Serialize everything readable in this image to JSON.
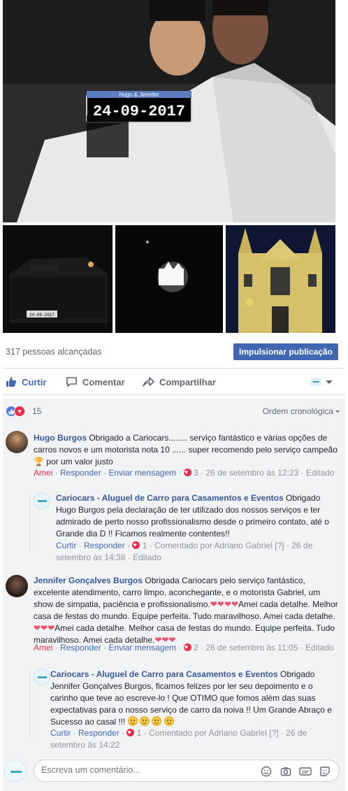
{
  "post": {
    "reach_text": "317 pessoas alcançadas",
    "boost_label": "Impulsionar publicação",
    "plate_name": "Hugo & Jennifer",
    "plate_date": "24-09-2017",
    "thumb1_plate": "24-09-2017"
  },
  "actions": {
    "like": "Curtir",
    "comment": "Comentar",
    "share": "Compartilhar"
  },
  "reactions": {
    "count": "15",
    "order_label": "Ordem cronológica"
  },
  "comments": [
    {
      "author": "Hugo Burgos",
      "text": "Obrigado a Cariocars........ serviço fantástico e várias opções de carros novos e um motorista nota 10 ...... super recomendo pelo serviço campeão 🏆 por um valor justo",
      "amei": "Amei",
      "reply": "Responder",
      "message": "Enviar mensagem",
      "react_count": "3",
      "date": "26 de setembro às 12:23",
      "edited": "Editado",
      "reply_item": {
        "author": "Cariocars - Aluguel de Carro para Casamentos e Eventos",
        "text": "Obrigado Hugo Burgos pela declaração de ter utilizado dos nossos serviços e ter admirado de perto nosso profissionalismo desde o primeiro contato, até o Grande dia D !! Ficamos realmente contentes!!",
        "like": "Curtir",
        "reply": "Responder",
        "react_count": "1",
        "commented_by": "Comentado por Adriano Gabriel",
        "help": "[?]",
        "date": "26 de setembro às 14:38",
        "edited": "Editado"
      }
    },
    {
      "author": "Jennifer Gonçalves Burgos",
      "text_a": "Obrigada Cariocars pelo serviço fantástico, excelente atendimento, carro limpo, aconchegante, e o motorista Gabriel, um show de simpatia, paciência e profissionalismo.",
      "text_b": "Amei cada detalhe. Melhor casa de festas do mundo. Equipe perfeita. Tudo maravilhoso. Amei cada detalhe.",
      "text_c": "Amei cada detalhe. Melhor casa de festas do mundo. Equipe perfeita. Tudo maravilhoso. Amei cada detalhe.",
      "hearts": "❤❤❤❤",
      "hearts3": "❤❤❤",
      "amei": "Amei",
      "reply": "Responder",
      "message": "Enviar mensagem",
      "react_count": "2",
      "date": "26 de setembro às 11:05",
      "edited": "Editado",
      "reply_item": {
        "author": "Cariocars - Aluguel de Carro para Casamentos e Eventos",
        "text": "Obrigado Jennifer Gonçalves Burgos, ficamos felizes por ler seu depoimento e o carinho que teve ao escreve-lo ! Que OTIMO que fomos além das suas expectativas para o nosso serviço de carro da noiva !! Um Grande Abraço e Sucesso ao casal !!!",
        "like": "Curtir",
        "reply": "Responder",
        "react_count": "1",
        "commented_by": "Comentado por Adriano Gabriel",
        "help": "[?]",
        "date": "26 de setembro às 14:22"
      }
    }
  ],
  "composer": {
    "placeholder": "Escreva um comentário...",
    "gif": "GIF"
  }
}
